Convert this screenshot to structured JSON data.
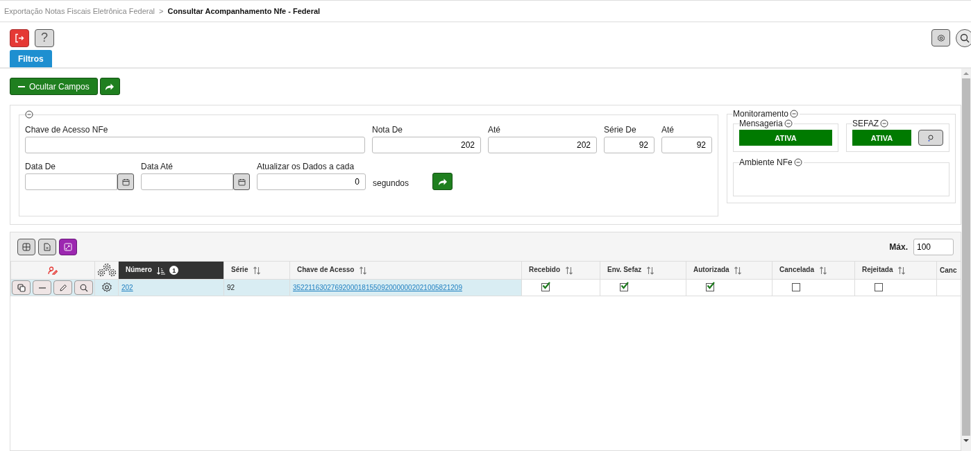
{
  "breadcrumb": {
    "items": [
      {
        "text": "Exportação Notas Fiscais Eletrônica Federal",
        "current": false
      },
      {
        "text": "Consultar Acompanhamento Nfe - Federal",
        "current": true
      }
    ],
    "separator": ">"
  },
  "toolbar": {
    "help_label": "?"
  },
  "tabs": [
    {
      "label": "Filtros",
      "selected": true
    }
  ],
  "toggle_fields_button": "Ocultar Campos",
  "filters": {
    "row_1": [
      {
        "label": "Chave de Acesso NFe",
        "kind": "text"
      },
      {
        "label": "Nota De",
        "value": "202",
        "kind": "text"
      },
      {
        "label": "Até",
        "value": "202",
        "kind": "text"
      },
      {
        "label": "Série De",
        "value": "92",
        "kind": "text"
      },
      {
        "label": "Até",
        "value": "92",
        "kind": "text"
      }
    ],
    "row_2": [
      {
        "label": "Data De",
        "kind": "date"
      },
      {
        "label": "Data Até",
        "kind": "date"
      },
      {
        "label": "Atualizar os Dados a cada",
        "value": "0",
        "kind": "text"
      }
    ],
    "unit": "segundos"
  },
  "monitoring": {
    "title": "Monitoramento",
    "mensageria": {
      "title": "Mensageria",
      "status": "ATIVA",
      "active": true
    },
    "sefaz": {
      "title": "SEFAZ",
      "status": "ATIVA",
      "active": true
    },
    "environment": {
      "title": "Ambiente NFe"
    }
  },
  "grid": {
    "max_label": "Máx.",
    "max_value": "100",
    "columns": [
      {
        "label": "Número",
        "selected": true,
        "sort_icon": true,
        "sorted": true,
        "sort_index": "1"
      },
      {
        "label": "Série",
        "selected": false,
        "sort_icon": true,
        "sorted": false
      },
      {
        "label": "Chave de Acesso",
        "selected": false,
        "sort_icon": true,
        "sorted": false
      },
      {
        "label": "Recebido",
        "selected": false,
        "sort_icon": true,
        "sorted": false
      },
      {
        "label": "Env. Sefaz",
        "selected": false,
        "sort_icon": true,
        "sorted": false
      },
      {
        "label": "Autorizada",
        "selected": false,
        "sort_icon": true,
        "sorted": false
      },
      {
        "label": "Cancelada",
        "selected": false,
        "sort_icon": true,
        "sorted": false
      },
      {
        "label": "Rejeitada",
        "selected": false,
        "sort_icon": true,
        "sorted": false
      },
      {
        "label": "Canc",
        "selected": false,
        "sort_icon": false
      }
    ],
    "rows": [
      {
        "selected": true,
        "cells": [
          {
            "kind": "link",
            "text": "202"
          },
          {
            "kind": "text",
            "text": "92"
          },
          {
            "kind": "link",
            "text": "35221163027692000181550920000002021005821209"
          },
          {
            "kind": "check",
            "checked": true
          },
          {
            "kind": "check",
            "checked": true
          },
          {
            "kind": "check",
            "checked": true
          },
          {
            "kind": "check",
            "checked": false
          },
          {
            "kind": "check",
            "checked": false
          },
          {
            "kind": "blank"
          }
        ]
      }
    ]
  }
}
